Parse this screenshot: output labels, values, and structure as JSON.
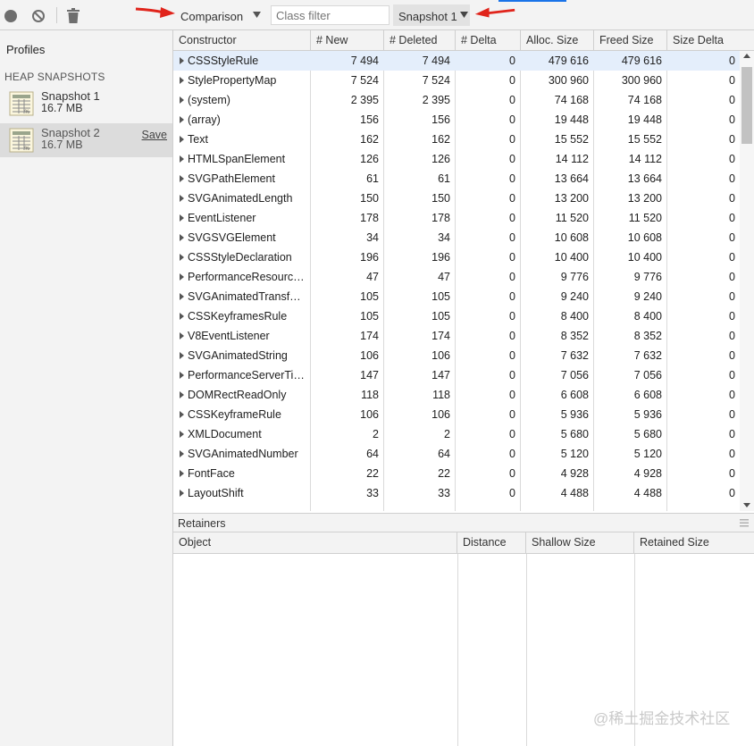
{
  "toolbar": {
    "view_mode": "Comparison",
    "filter_placeholder": "Class filter",
    "base_snapshot": "Snapshot 1",
    "accent_color": "#1a73e8",
    "annotation_arrow_color": "#e0241b"
  },
  "sidebar": {
    "title": "Profiles",
    "section_heading": "HEAP SNAPSHOTS",
    "snapshots": [
      {
        "name": "Snapshot 1",
        "size": "16.7 MB",
        "selected": false
      },
      {
        "name": "Snapshot 2",
        "size": "16.7 MB",
        "selected": true,
        "action": "Save"
      }
    ]
  },
  "grid": {
    "columns": [
      "Constructor",
      "# New",
      "# Deleted",
      "# Delta",
      "Alloc. Size",
      "Freed Size",
      "Size Delta"
    ],
    "rows": [
      [
        "CSSStyleRule",
        "7 494",
        "7 494",
        "0",
        "479 616",
        "479 616",
        "0"
      ],
      [
        "StylePropertyMap",
        "7 524",
        "7 524",
        "0",
        "300 960",
        "300 960",
        "0"
      ],
      [
        "(system)",
        "2 395",
        "2 395",
        "0",
        "74 168",
        "74 168",
        "0"
      ],
      [
        "(array)",
        "156",
        "156",
        "0",
        "19 448",
        "19 448",
        "0"
      ],
      [
        "Text",
        "162",
        "162",
        "0",
        "15 552",
        "15 552",
        "0"
      ],
      [
        "HTMLSpanElement",
        "126",
        "126",
        "0",
        "14 112",
        "14 112",
        "0"
      ],
      [
        "SVGPathElement",
        "61",
        "61",
        "0",
        "13 664",
        "13 664",
        "0"
      ],
      [
        "SVGAnimatedLength",
        "150",
        "150",
        "0",
        "13 200",
        "13 200",
        "0"
      ],
      [
        "EventListener",
        "178",
        "178",
        "0",
        "11 520",
        "11 520",
        "0"
      ],
      [
        "SVGSVGElement",
        "34",
        "34",
        "0",
        "10 608",
        "10 608",
        "0"
      ],
      [
        "CSSStyleDeclaration",
        "196",
        "196",
        "0",
        "10 400",
        "10 400",
        "0"
      ],
      [
        "PerformanceResourc…",
        "47",
        "47",
        "0",
        "9 776",
        "9 776",
        "0"
      ],
      [
        "SVGAnimatedTransf…",
        "105",
        "105",
        "0",
        "9 240",
        "9 240",
        "0"
      ],
      [
        "CSSKeyframesRule",
        "105",
        "105",
        "0",
        "8 400",
        "8 400",
        "0"
      ],
      [
        "V8EventListener",
        "174",
        "174",
        "0",
        "8 352",
        "8 352",
        "0"
      ],
      [
        "SVGAnimatedString",
        "106",
        "106",
        "0",
        "7 632",
        "7 632",
        "0"
      ],
      [
        "PerformanceServerTi…",
        "147",
        "147",
        "0",
        "7 056",
        "7 056",
        "0"
      ],
      [
        "DOMRectReadOnly",
        "118",
        "118",
        "0",
        "6 608",
        "6 608",
        "0"
      ],
      [
        "CSSKeyframeRule",
        "106",
        "106",
        "0",
        "5 936",
        "5 936",
        "0"
      ],
      [
        "XMLDocument",
        "2",
        "2",
        "0",
        "5 680",
        "5 680",
        "0"
      ],
      [
        "SVGAnimatedNumber",
        "64",
        "64",
        "0",
        "5 120",
        "5 120",
        "0"
      ],
      [
        "FontFace",
        "22",
        "22",
        "0",
        "4 928",
        "4 928",
        "0"
      ],
      [
        "LayoutShift",
        "33",
        "33",
        "0",
        "4 488",
        "4 488",
        "0"
      ]
    ]
  },
  "retainers": {
    "title": "Retainers",
    "columns": [
      "Object",
      "Distance",
      "Shallow Size",
      "Retained Size"
    ]
  },
  "watermark": "@稀土掘金技术社区"
}
